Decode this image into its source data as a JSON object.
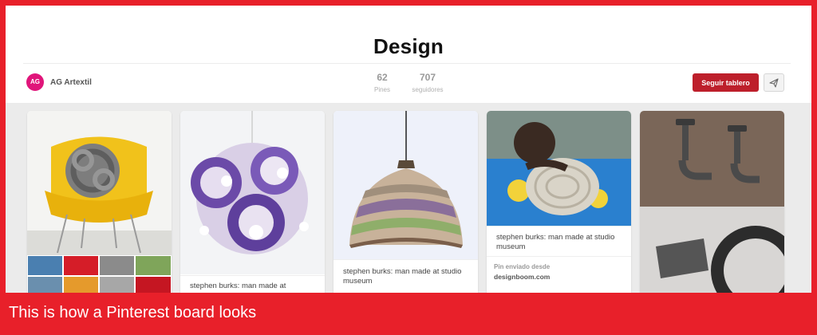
{
  "board": {
    "title": "Design",
    "owner": {
      "name": "AG Artextil",
      "avatar_text": "AG"
    },
    "stats": [
      {
        "value": "62",
        "label": "Pines"
      },
      {
        "value": "707",
        "label": "seguidores"
      }
    ],
    "follow_button": "Seguir tablero",
    "send_icon": "paper-plane-icon"
  },
  "pins": [
    {
      "caption": ""
    },
    {
      "caption": "stephen burks: man made at"
    },
    {
      "caption": "stephen burks: man made at studio museum"
    },
    {
      "caption": "stephen burks: man made at studio museum",
      "source_label": "Pin enviado desde",
      "source_domain": "designboom.com"
    },
    {
      "caption": ""
    }
  ],
  "banner": {
    "text": "This is how a Pinterest board looks"
  },
  "colors": {
    "frame": "#e8202a",
    "follow_button": "#bd1f2b",
    "avatar": "#e0157a",
    "grid_bg": "#ebebeb"
  }
}
